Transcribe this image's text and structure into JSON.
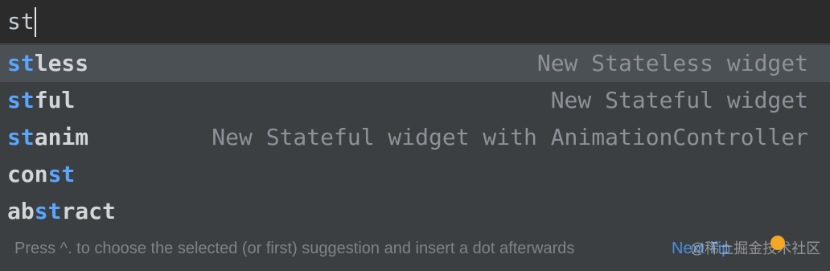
{
  "editor": {
    "typed_text": "st"
  },
  "completion": {
    "items": [
      {
        "prefix": "",
        "match": "st",
        "rest": "less",
        "description": "New Stateless widget",
        "selected": true
      },
      {
        "prefix": "",
        "match": "st",
        "rest": "ful",
        "description": "New Stateful widget",
        "selected": false
      },
      {
        "prefix": "",
        "match": "st",
        "rest": "anim",
        "description": "New Stateful widget with AnimationController",
        "selected": false
      },
      {
        "prefix": "con",
        "match": "st",
        "rest": "",
        "description": "",
        "selected": false
      },
      {
        "prefix": "ab",
        "match": "st",
        "rest": "ract",
        "description": "",
        "selected": false
      }
    ],
    "hint": "Press ^. to choose the selected (or first) suggestion and insert a dot afterwards",
    "next_tip": "Next Tip"
  },
  "watermark": {
    "text": "@稀土掘金技术社区"
  },
  "colors": {
    "match_highlight": "#5aa6ff",
    "selected_row": "#4b5055",
    "popup_bg": "#3c3f41",
    "link": "#4a8fe0"
  }
}
